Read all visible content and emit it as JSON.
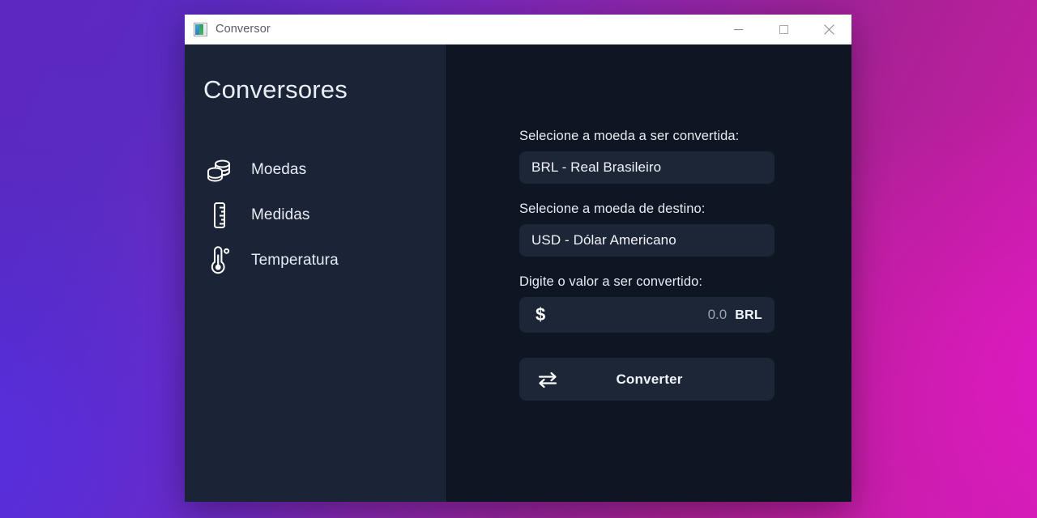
{
  "window": {
    "title": "Conversor",
    "app_icon": "image-app-icon",
    "controls": {
      "minimize": "minimize-icon",
      "maximize": "maximize-icon",
      "close": "close-icon"
    }
  },
  "sidebar": {
    "title": "Conversores",
    "items": [
      {
        "label": "Moedas",
        "icon": "coins-icon"
      },
      {
        "label": "Medidas",
        "icon": "ruler-icon"
      },
      {
        "label": "Temperatura",
        "icon": "thermometer-icon"
      }
    ]
  },
  "main": {
    "source_currency": {
      "label": "Selecione a moeda a ser convertida:",
      "value": "BRL - Real Brasileiro"
    },
    "target_currency": {
      "label": "Selecione a moeda de destino:",
      "value": "USD - Dólar Americano"
    },
    "amount": {
      "label": "Digite o valor a ser convertido:",
      "symbol": "$",
      "value": "0.0",
      "suffix": "BRL"
    },
    "convert_button": {
      "label": "Converter",
      "icon": "swap-arrows-icon"
    }
  },
  "colors": {
    "sidebar_bg": "#1b2336",
    "main_bg": "#0f1623",
    "field_bg": "#1d2637",
    "text_primary": "#f0f3f8",
    "text_muted": "#9aa3b4",
    "titlebar_bg": "#ffffff",
    "gradient_start": "#5a29bd",
    "gradient_end": "#d81fbe"
  }
}
